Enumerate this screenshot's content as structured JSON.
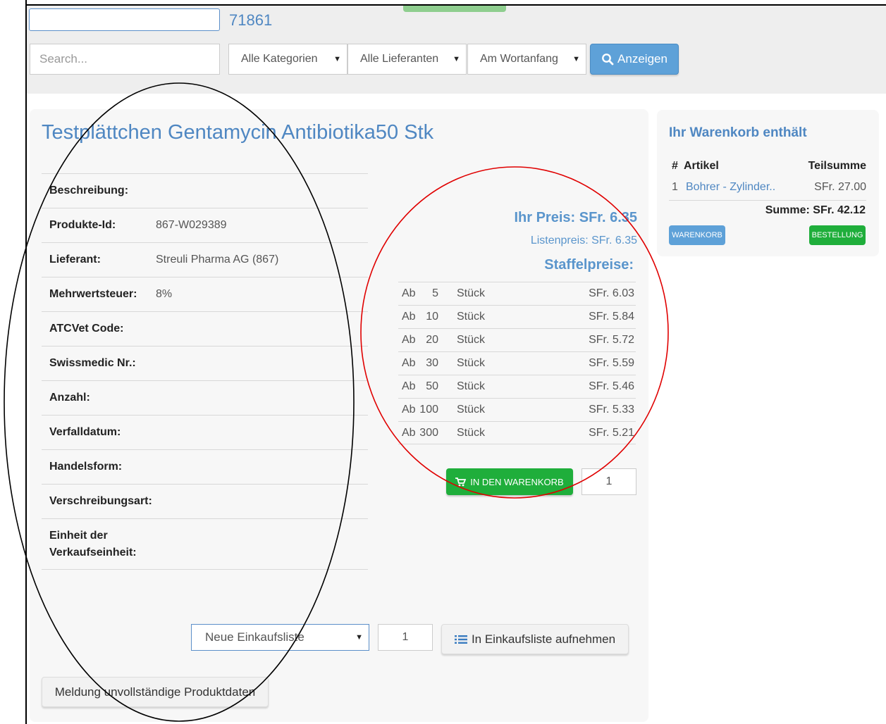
{
  "header": {
    "order_number": "71861",
    "search_placeholder": "Search...",
    "category_select": "Alle Kategorien",
    "supplier_select": "Alle Lieferanten",
    "match_select": "Am Wortanfang",
    "show_button": "Anzeigen"
  },
  "product": {
    "title": "Testplättchen Gentamycin Antibiotika50 Stk",
    "details": [
      {
        "label": "Beschreibung:",
        "value": ""
      },
      {
        "label": "Produkte-Id:",
        "value": "867-W029389"
      },
      {
        "label": "Lieferant:",
        "value": "Streuli Pharma AG (867)"
      },
      {
        "label": "Mehrwertsteuer:",
        "value": "8%"
      },
      {
        "label": "ATCVet Code:",
        "value": ""
      },
      {
        "label": "Swissmedic Nr.:",
        "value": ""
      },
      {
        "label": "Anzahl:",
        "value": ""
      },
      {
        "label": "Verfalldatum:",
        "value": ""
      },
      {
        "label": "Handelsform:",
        "value": ""
      },
      {
        "label": "Verschreibungsart:",
        "value": ""
      },
      {
        "label": "Einheit der Verkaufseinheit:",
        "value": ""
      }
    ],
    "your_price": "Ihr Preis: SFr. 6.35",
    "list_price": "Listenpreis: SFr. 6.35",
    "tier_title": "Staffelpreise:",
    "tiers": [
      {
        "ab": "Ab",
        "qty": "5",
        "unit": "Stück",
        "price": "SFr. 6.03"
      },
      {
        "ab": "Ab",
        "qty": "10",
        "unit": "Stück",
        "price": "SFr. 5.84"
      },
      {
        "ab": "Ab",
        "qty": "20",
        "unit": "Stück",
        "price": "SFr. 5.72"
      },
      {
        "ab": "Ab",
        "qty": "30",
        "unit": "Stück",
        "price": "SFr. 5.59"
      },
      {
        "ab": "Ab",
        "qty": "50",
        "unit": "Stück",
        "price": "SFr. 5.46"
      },
      {
        "ab": "Ab",
        "qty": "100",
        "unit": "Stück",
        "price": "SFr. 5.33"
      },
      {
        "ab": "Ab",
        "qty": "300",
        "unit": "Stück",
        "price": "SFr. 5.21"
      }
    ],
    "add_to_cart_label": "IN DEN WARENKORB",
    "cart_qty": "1",
    "shopping_list_select": "Neue Einkaufsliste",
    "shopping_list_qty": "1",
    "add_to_list_label": "In Einkaufsliste aufnehmen",
    "report_label": "Meldung unvollständige Produktdaten"
  },
  "cart": {
    "title": "Ihr Warenkorb enthält",
    "col_num": "#",
    "col_article": "Artikel",
    "col_subtotal": "Teilsumme",
    "items": [
      {
        "num": "1",
        "article": "Bohrer - Zylinder..",
        "subtotal": "SFr. 27.00"
      }
    ],
    "sum": "Summe: SFr. 42.12",
    "cart_button": "WARENKORB",
    "order_button": "BESTELLUNG"
  },
  "colors": {
    "accent_blue": "#4f87c2",
    "button_blue": "#5ea1d8",
    "button_green": "#1fae3b",
    "annotation_black": "#000000",
    "annotation_red": "#e00000"
  }
}
